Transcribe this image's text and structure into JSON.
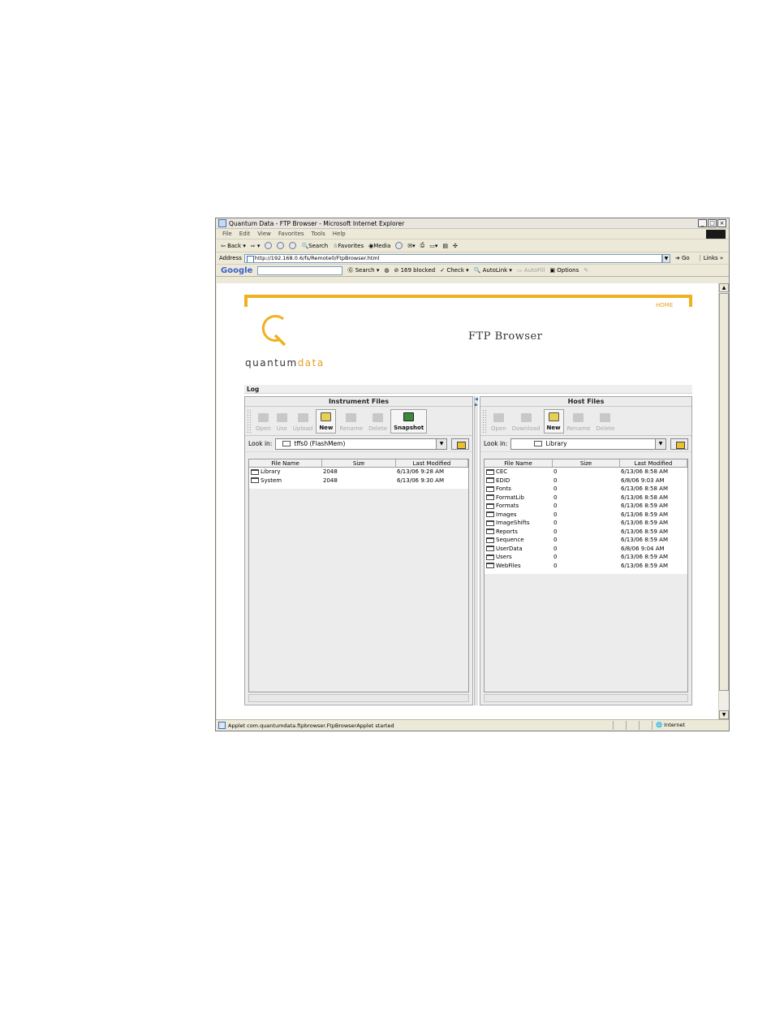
{
  "window": {
    "title": "Quantum Data - FTP Browser - Microsoft Internet Explorer",
    "controls": [
      "_",
      "□",
      "×"
    ]
  },
  "menu": [
    "File",
    "Edit",
    "View",
    "Favorites",
    "Tools",
    "Help"
  ],
  "toolbar": {
    "back": "Back",
    "search": "Search",
    "favorites": "Favorites",
    "media": "Media"
  },
  "address": {
    "label": "Address",
    "url": "http://192.168.0.6/fs/Remote0/FtpBrowser.html",
    "go": "Go",
    "links": "Links »"
  },
  "google_bar": {
    "logo": "Google",
    "search": "Search",
    "blocked": "169 blocked",
    "check": "Check",
    "autolink": "AutoLink",
    "autofill": "AutoFill",
    "options": "Options"
  },
  "page": {
    "home_link": "HOME",
    "brand_main": "quantum",
    "brand_accent": "data",
    "title": "FTP Browser",
    "log_label": "Log"
  },
  "instrument": {
    "title": "Instrument Files",
    "tools": [
      {
        "label": "Open",
        "enabled": false
      },
      {
        "label": "Use",
        "enabled": false
      },
      {
        "label": "Upload",
        "enabled": false
      },
      {
        "label": "New",
        "enabled": true
      },
      {
        "label": "Rename",
        "enabled": false
      },
      {
        "label": "Delete",
        "enabled": false
      },
      {
        "label": "Snapshot",
        "enabled": true
      }
    ],
    "look_in_label": "Look in:",
    "look_in_value": "tffs0  (FlashMem)",
    "columns": [
      "File Name",
      "Size",
      "Last Modified"
    ],
    "rows": [
      {
        "name": "Library",
        "size": "2048",
        "modified": "6/13/06 9:28 AM"
      },
      {
        "name": "System",
        "size": "2048",
        "modified": "6/13/06 9:30 AM"
      }
    ]
  },
  "host": {
    "title": "Host Files",
    "tools": [
      {
        "label": "Open",
        "enabled": false
      },
      {
        "label": "Download",
        "enabled": false
      },
      {
        "label": "New",
        "enabled": true
      },
      {
        "label": "Rename",
        "enabled": false
      },
      {
        "label": "Delete",
        "enabled": false
      }
    ],
    "look_in_label": "Look in:",
    "look_in_value": "Library",
    "columns": [
      "File Name",
      "Size",
      "Last Modified"
    ],
    "rows": [
      {
        "name": "CEC",
        "size": "0",
        "modified": "6/13/06 8:58 AM"
      },
      {
        "name": "EDID",
        "size": "0",
        "modified": "6/8/06 9:03 AM"
      },
      {
        "name": "Fonts",
        "size": "0",
        "modified": "6/13/06 8:58 AM"
      },
      {
        "name": "FormatLib",
        "size": "0",
        "modified": "6/13/06 8:58 AM"
      },
      {
        "name": "Formats",
        "size": "0",
        "modified": "6/13/06 8:59 AM"
      },
      {
        "name": "Images",
        "size": "0",
        "modified": "6/13/06 8:59 AM"
      },
      {
        "name": "ImageShifts",
        "size": "0",
        "modified": "6/13/06 8:59 AM"
      },
      {
        "name": "Reports",
        "size": "0",
        "modified": "6/13/06 8:59 AM"
      },
      {
        "name": "Sequence",
        "size": "0",
        "modified": "6/13/06 8:59 AM"
      },
      {
        "name": "UserData",
        "size": "0",
        "modified": "6/8/06 9:04 AM"
      },
      {
        "name": "Users",
        "size": "0",
        "modified": "6/13/06 8:59 AM"
      },
      {
        "name": "WebFiles",
        "size": "0",
        "modified": "6/13/06 8:59 AM"
      }
    ]
  },
  "status": {
    "text": "Applet com.quantumdata.ftpbrowser.FtpBrowserApplet started",
    "zone": "Internet"
  },
  "colors": {
    "accent": "#f0b020",
    "brand_accent": "#e8a020"
  }
}
